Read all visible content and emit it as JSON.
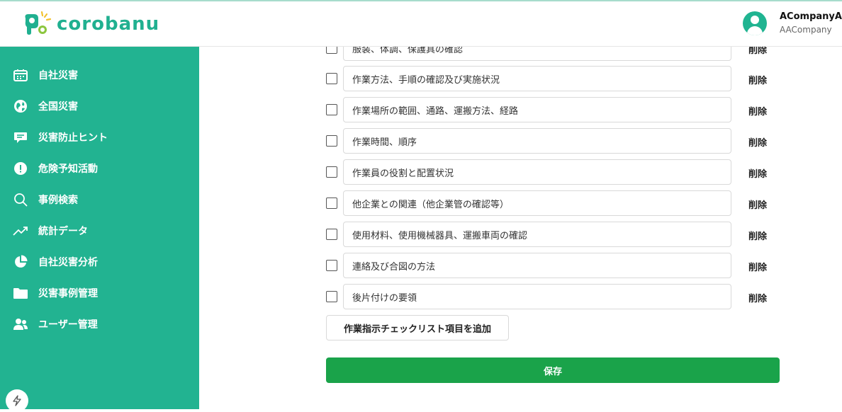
{
  "app": {
    "logo_text": "corobanu",
    "brand_color": "#20b090"
  },
  "user": {
    "name": "ACompanyAc",
    "company": "AACompany"
  },
  "sidebar": {
    "color": "#22b391",
    "items": [
      {
        "label": "自社災害",
        "icon": "calendar-icon"
      },
      {
        "label": "全国災害",
        "icon": "globe-icon"
      },
      {
        "label": "災害防止ヒント",
        "icon": "chat-bubble-icon"
      },
      {
        "label": "危険予知活動",
        "icon": "alert-circle-icon"
      },
      {
        "label": "事例検索",
        "icon": "search-icon"
      },
      {
        "label": "統計データ",
        "icon": "trend-up-icon"
      },
      {
        "label": "自社災害分析",
        "icon": "pie-chart-icon"
      },
      {
        "label": "災害事例管理",
        "icon": "folder-icon"
      },
      {
        "label": "ユーザー管理",
        "icon": "users-icon"
      }
    ],
    "footer_icon": "bolt-icon"
  },
  "checklist": {
    "delete_label": "削除",
    "items": [
      "服装、体調、保護具の確認",
      "作業方法、手順の確認及び実施状況",
      "作業場所の範囲、通路、運搬方法、経路",
      "作業時間、順序",
      "作業員の役割と配置状況",
      "他企業との関連（他企業管の確認等）",
      "使用材料、使用機械器具、運搬車両の確認",
      "連絡及び合図の方法",
      "後片付けの要領"
    ],
    "add_label": "作業指示チェックリスト項目を追加",
    "save_label": "保存",
    "save_color": "#1aa34a"
  }
}
